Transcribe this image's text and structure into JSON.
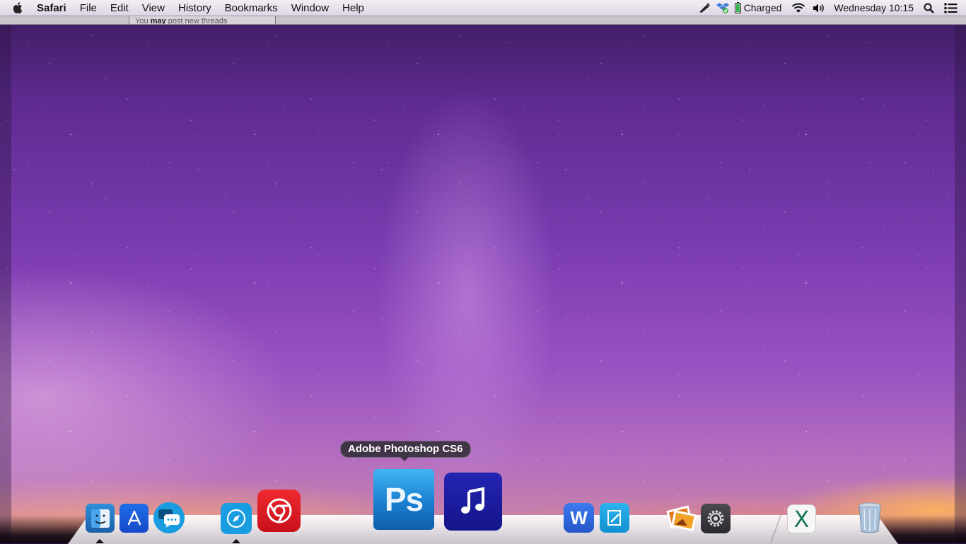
{
  "menubar": {
    "apple": "apple-menu",
    "app_name": "Safari",
    "items": [
      "File",
      "Edit",
      "View",
      "History",
      "Bookmarks",
      "Window",
      "Help"
    ],
    "status": {
      "battery": "Charged",
      "datetime": "Wednesday 10:15"
    }
  },
  "page_strip": {
    "prefix": "You ",
    "bold": "may",
    "suffix": " post new threads"
  },
  "tooltip": "Adobe Photoshop CS6",
  "dock": {
    "apps": [
      {
        "name": "Finder",
        "icon": "finder-icon"
      },
      {
        "name": "App Store",
        "icon": "app-store-icon"
      },
      {
        "name": "Messages",
        "icon": "messages-icon"
      },
      {
        "name": "Safari",
        "icon": "safari-icon"
      },
      {
        "name": "Google Chrome",
        "icon": "chrome-icon"
      },
      {
        "name": "Adobe Photoshop CS6",
        "icon": "photoshop-icon",
        "label": "Ps"
      },
      {
        "name": "iTunes",
        "icon": "music-icon"
      },
      {
        "name": "Word",
        "icon": "word-icon",
        "label": "W"
      },
      {
        "name": "Pages",
        "icon": "pages-icon"
      },
      {
        "name": "Preview",
        "icon": "preview-icon"
      },
      {
        "name": "System Preferences",
        "icon": "gear-icon"
      },
      {
        "name": "X",
        "icon": "x-icon",
        "label": "X"
      },
      {
        "name": "Trash",
        "icon": "trash-icon"
      }
    ]
  },
  "colors": {
    "menubar": "#e8e3ec",
    "photoshop_blue": "#1a7fd0",
    "itunes_blue": "#1a1a9c",
    "chrome_red": "#e0151e"
  }
}
